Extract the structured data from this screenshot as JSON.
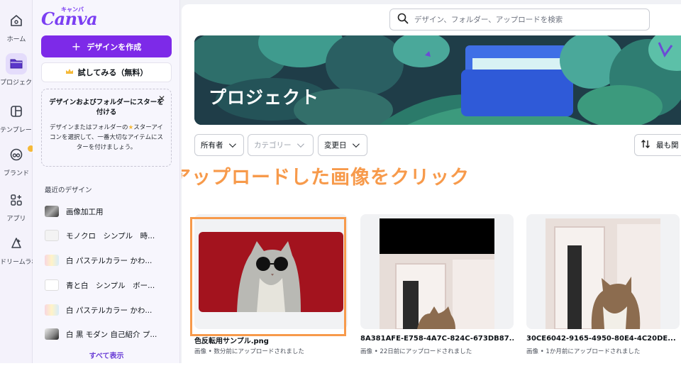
{
  "rail": {
    "items": [
      {
        "label": "ホーム"
      },
      {
        "label": "プロジェクト"
      },
      {
        "label": "テンプレート"
      },
      {
        "label": "ブランド"
      },
      {
        "label": "アプリ"
      },
      {
        "label": "ドリームラボ"
      }
    ]
  },
  "panel": {
    "logo": "Canva",
    "logo_sub": "キャンバ",
    "create_button": "デザインを作成",
    "try_button": "試してみる（無料）",
    "star_tip": {
      "title": "デザインおよびフォルダーにスターを付ける",
      "body_before": "デザインまたはフォルダーの",
      "body_after": "スターアイコンを選択して、一番大切なアイテムにスターを付けましょう。"
    },
    "recent_title": "最近のデザイン",
    "recent": [
      {
        "label": "画像加工用"
      },
      {
        "label": "モノクロ　シンプル　時..."
      },
      {
        "label": "白 パステルカラー かわ..."
      },
      {
        "label": "青と白　シンプル　ボー..."
      },
      {
        "label": "白 パステルカラー かわ..."
      },
      {
        "label": "白 黒 モダン 自己紹介 プ..."
      }
    ],
    "show_all": "すべて表示"
  },
  "main": {
    "search_placeholder": "デザイン、フォルダー、アップロードを検索",
    "hero_title": "プロジェクト",
    "filters": [
      {
        "label": "所有者"
      },
      {
        "label": "カテゴリー"
      },
      {
        "label": "変更日"
      }
    ],
    "sort_label": "最も関",
    "annotation": "アップロードした画像をクリック",
    "cards": [
      {
        "name": "色反転用サンプル.png",
        "meta": "画像 • 数分前にアップロードされました"
      },
      {
        "name": "8A381AFE-E758-4A7C-824C-673DB87...",
        "meta": "画像 • 22日前にアップロードされました"
      },
      {
        "name": "30CE6042-9165-4950-80E4-4C20DE...",
        "meta": "画像 • 1か月前にアップロードされました"
      }
    ]
  },
  "colors": {
    "brand_purple": "#7d2ae8",
    "annotation_orange": "#f79a4b",
    "hero_teal": "#1e3a46",
    "card_red": "#a3131e"
  }
}
